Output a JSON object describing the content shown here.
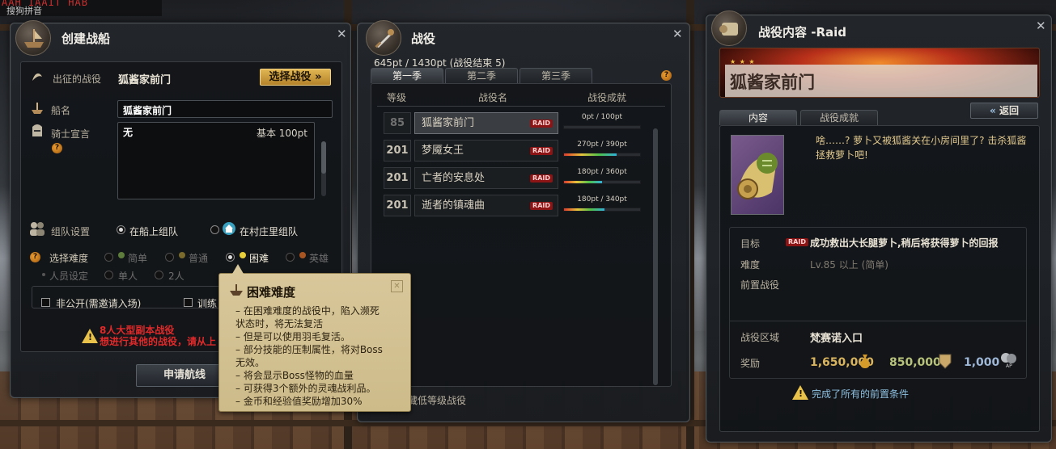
{
  "ime": {
    "top_text": "AAH IAAIT HAB",
    "input_label": "搜狗拼音"
  },
  "ship": {
    "title": "创建战船",
    "campaign_label": "出征的战役",
    "campaign_value": "狐酱家前门",
    "choose_button": "选择战役",
    "name_label": "船名",
    "name_value": "狐酱家前门",
    "oath_label": "骑士宣言",
    "oath_text": "无",
    "oath_base": "基本 100pt",
    "team_label": "组队设置",
    "team_option1": "在船上组队",
    "team_option2": "在村庄里组队",
    "difficulty_label": "选择难度",
    "difficulty_options": [
      "简单",
      "普通",
      "困难",
      "英雄"
    ],
    "people_label": "人员设定",
    "people_options": [
      "单人",
      "2人"
    ],
    "private_label": "非公开(需邀请入场)",
    "training_label": "训练",
    "warning_line1": "8人大型副本战役",
    "warning_line2": "想进行其他的战役，请从上",
    "apply_button": "申请航线"
  },
  "campaign": {
    "title": "战役",
    "points": "645pt / 1430pt (战役结束 5)",
    "tabs": [
      "第一季",
      "第二季",
      "第三季"
    ],
    "col_level": "等级",
    "col_name": "战役名",
    "col_progress": "战役成就",
    "rows": [
      {
        "level": "85",
        "name": "狐酱家前门",
        "badge": "RAID",
        "progress": "0pt / 100pt",
        "ratio": 0.0
      },
      {
        "level": "201",
        "name": "梦魇女王",
        "badge": "RAID",
        "progress": "270pt / 390pt",
        "ratio": 0.69
      },
      {
        "level": "201",
        "name": "亡者的安息处",
        "badge": "RAID",
        "progress": "180pt / 360pt",
        "ratio": 0.5
      },
      {
        "level": "201",
        "name": "逝者的镇魂曲",
        "badge": "RAID",
        "progress": "180pt / 340pt",
        "ratio": 0.53
      }
    ],
    "footer_check": "隐藏低等级战役"
  },
  "tooltip": {
    "title": "困难难度",
    "lines": [
      "– 在困难难度的战役中，陷入濒死",
      "状态时，将无法复活",
      "– 但是可以使用羽毛复活。",
      "– 部分技能的压制属性，将对Boss",
      "无效。",
      "– 将会显示Boss怪物的血量",
      "– 可获得3个额外的灵魂战利品。",
      "– 金币和经验值奖励增加30%"
    ]
  },
  "detail": {
    "title": "战役内容 -Raid",
    "banner_stars": "★ ★ ★",
    "banner_name": "狐酱家前门",
    "tabs": [
      "内容",
      "战役成就"
    ],
    "back_button": "返回",
    "description": "啥……? 萝卜又被狐酱关在小房间里了? 击杀狐酱拯救萝卜吧!",
    "target_label": "目标",
    "target_badge": "RAID",
    "target_value": "成功救出大长腿萝卜,稍后将获得萝卜的回报",
    "level_label": "难度",
    "level_value": "Lv.85 以上 (简单)",
    "prereq_label": "前置战役",
    "area_label": "战役区域",
    "area_value": "梵赛诺入口",
    "reward_label": "奖励",
    "reward_gold": "1,650,000",
    "reward_exp": "850,000",
    "reward_ap": "1,000",
    "ap_tag": "AP",
    "complete_text": "完成了所有的前置条件"
  },
  "colors": {
    "accent_gold": "#e0b552",
    "raid_red": "#8c1414",
    "warning_red": "#e02a2a"
  }
}
